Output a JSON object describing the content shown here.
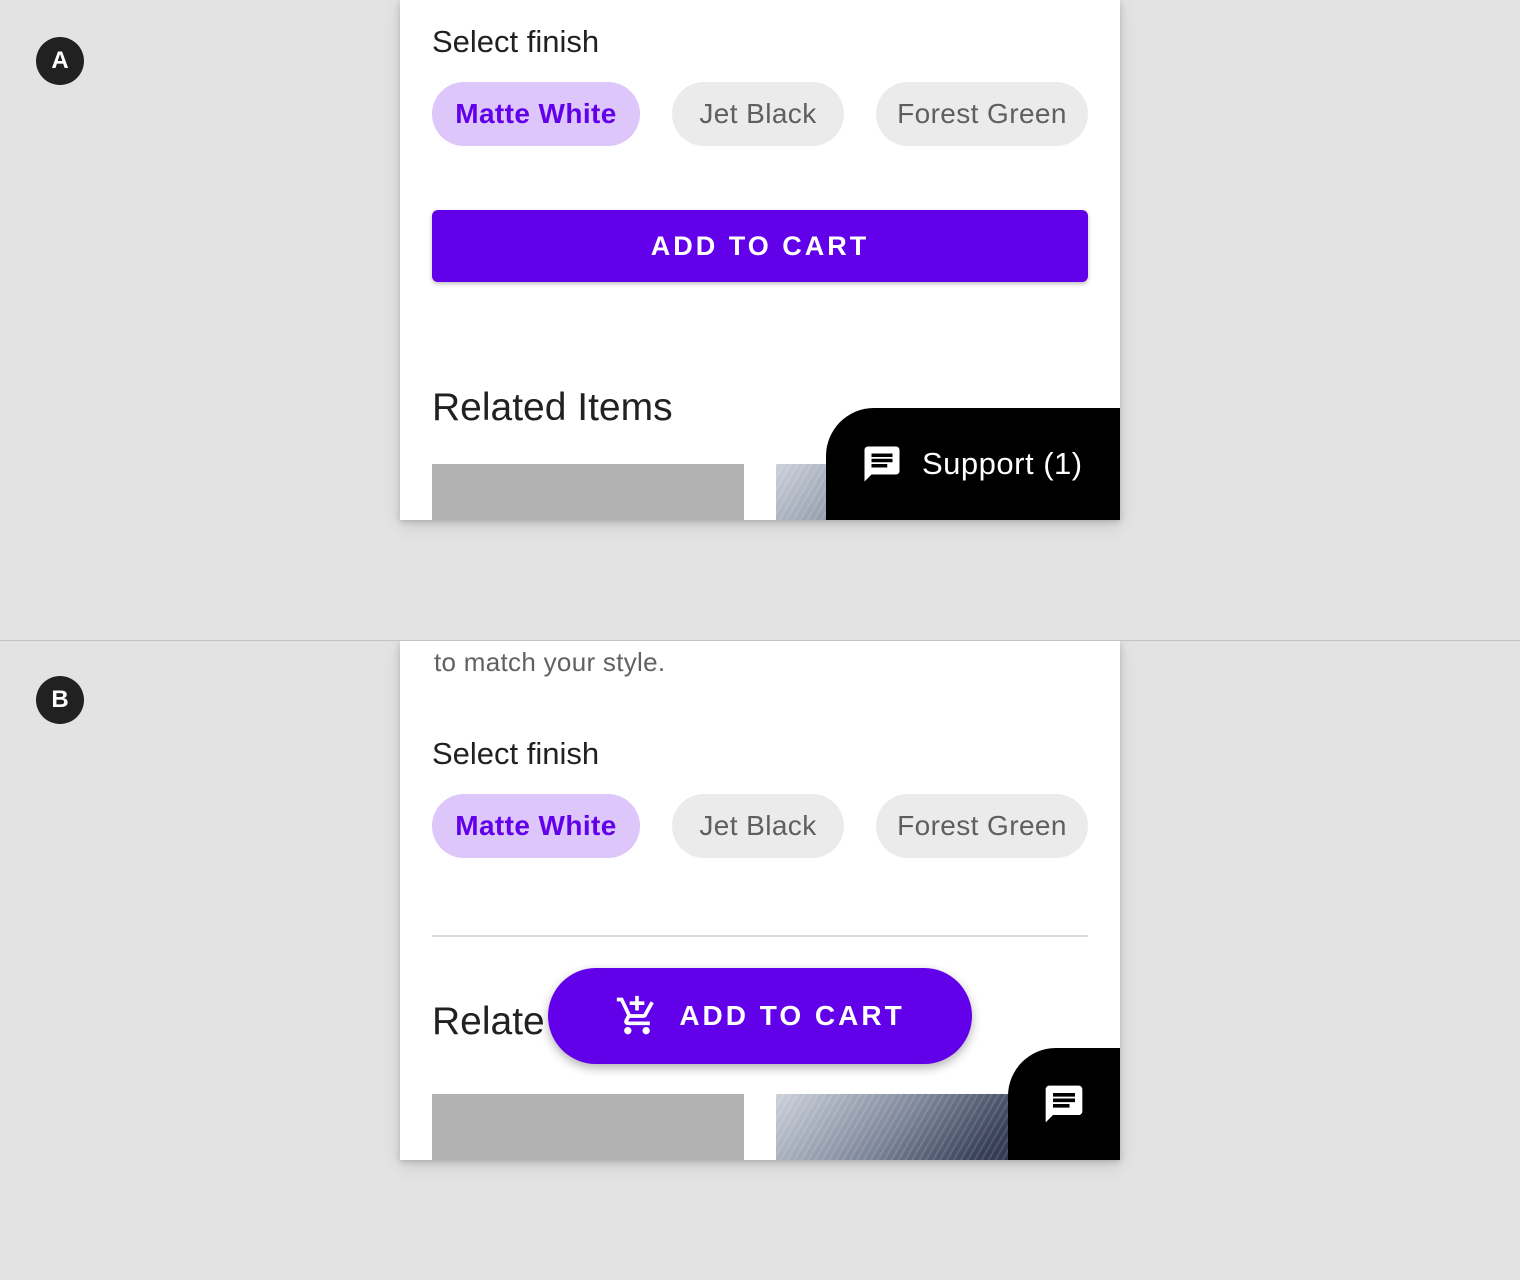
{
  "markers": {
    "a": "A",
    "b": "B"
  },
  "description_tail": "to match your style.",
  "finish": {
    "label": "Select finish",
    "options": [
      "Matte White",
      "Jet Black",
      "Forest Green"
    ],
    "selected": "Matte White"
  },
  "cart": {
    "label": "ADD TO CART"
  },
  "related": {
    "heading_full": "Related Items",
    "heading_partial": "Relate"
  },
  "support": {
    "label": "Support (1)"
  },
  "icons": {
    "chat": "chat-icon",
    "cart": "add-shopping-cart-icon"
  },
  "colors": {
    "accent": "#6200ea",
    "chip_selected_bg": "#dcc6fa",
    "chip_bg": "#ebebeb",
    "support_bg": "#000000"
  }
}
